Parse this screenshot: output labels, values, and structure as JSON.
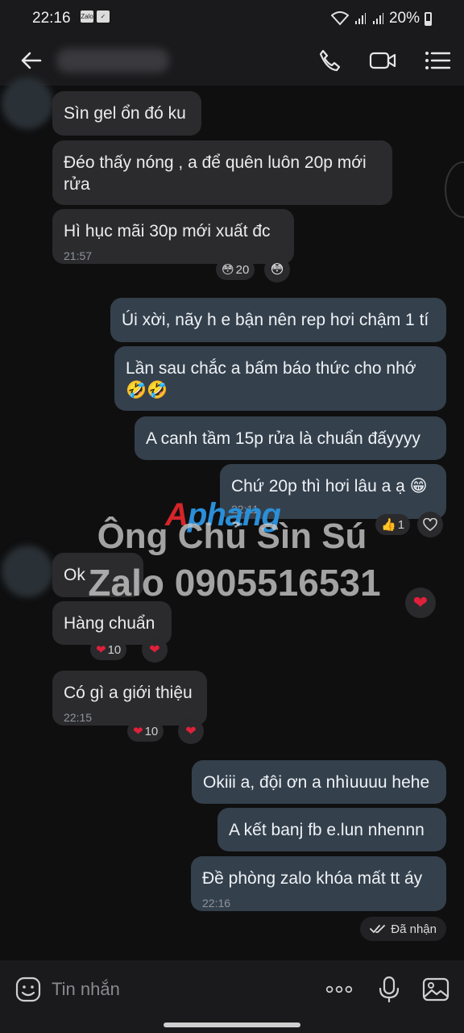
{
  "status_bar": {
    "time": "22:16",
    "battery": "20%"
  },
  "header": {
    "back_icon": "arrow-left-icon",
    "call_icon": "phone-icon",
    "video_icon": "video-camera-icon",
    "menu_icon": "list-menu-icon"
  },
  "messages": [
    {
      "text": "Sìn gel ổn đó ku"
    },
    {
      "text": "Đéo thấy nóng , a để quên luôn 20p mới rửa"
    },
    {
      "text": "Hì hục mãi 30p mới xuất đc",
      "time": "21:57",
      "reaction_count": "20"
    },
    {
      "text": "Úi xời, nãy h e bận nên rep hơi chậm 1 tí"
    },
    {
      "text": "Lần sau chắc a bấm báo thức cho nhớ 🤣🤣"
    },
    {
      "text": "A canh tầm 15p rửa là chuẩn đấyyyy"
    },
    {
      "text": "Chứ 20p thì hơi lâu a ạ 😁",
      "time": "22:11",
      "reaction_count": "1"
    },
    {
      "text": "Ok"
    },
    {
      "text": "Hàng chuẩn",
      "reaction_count": "10"
    },
    {
      "text": "Có gì a giới thiệu",
      "time": "22:15",
      "reaction_count": "10"
    },
    {
      "text": "Okiii a, đội ơn a nhìuuuu hehe"
    },
    {
      "text": "A kết banj fb e.lun nhennn"
    },
    {
      "text": "Đề phòng zalo khóa mất tt áy",
      "time": "22:16"
    }
  ],
  "watermark": {
    "brand_a": "A",
    "brand_b": "phang",
    "line1": "Ông Chủ Sìn Sú",
    "line2": "Zalo 0905516531"
  },
  "receipt": "Đã nhận",
  "composer": {
    "placeholder": "Tin nhắn"
  }
}
